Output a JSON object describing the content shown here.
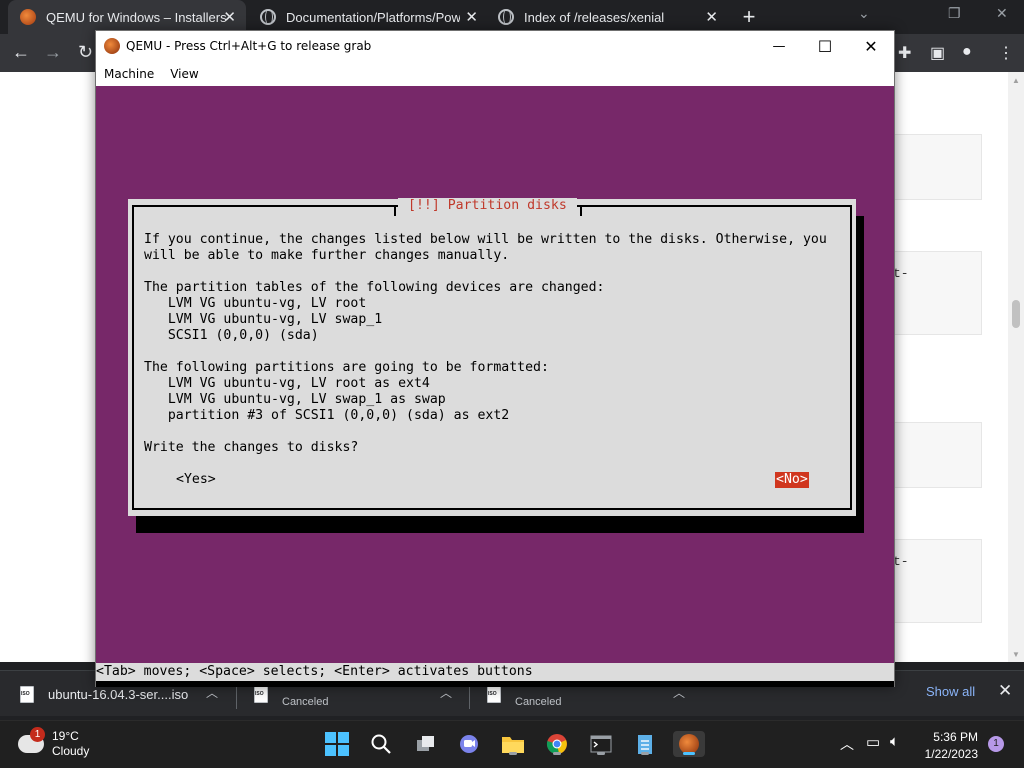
{
  "browser": {
    "tabs": [
      {
        "title": "QEMU for Windows – Installers (",
        "close": "✕"
      },
      {
        "title": "Documentation/Platforms/Power",
        "close": "✕"
      },
      {
        "title": "Index of /releases/xenial",
        "close": "✕"
      }
    ],
    "new_tab": "+",
    "page_fragments": [
      "t-",
      "t-"
    ]
  },
  "qemu": {
    "title": "QEMU - Press Ctrl+Alt+G to release grab",
    "menu": [
      "Machine",
      "View"
    ],
    "minimize": "—",
    "maximize": "☐",
    "close": "✕"
  },
  "dialog": {
    "title": "[!!] Partition disks",
    "lines": [
      "If you continue, the changes listed below will be written to the disks. Otherwise, you",
      "will be able to make further changes manually.",
      "",
      "The partition tables of the following devices are changed:",
      "   LVM VG ubuntu-vg, LV root",
      "   LVM VG ubuntu-vg, LV swap_1",
      "   SCSI1 (0,0,0) (sda)",
      "",
      "The following partitions are going to be formatted:",
      "   LVM VG ubuntu-vg, LV root as ext4",
      "   LVM VG ubuntu-vg, LV swap_1 as swap",
      "   partition #3 of SCSI1 (0,0,0) (sda) as ext2",
      "",
      "Write the changes to disks?"
    ],
    "yes_label": "<Yes>",
    "no_label": "<No>"
  },
  "status_line": "<Tab> moves; <Space> selects; <Enter> activates buttons",
  "downloads": {
    "items": [
      {
        "name": "ubuntu-16.04.3-ser....iso",
        "status": ""
      },
      {
        "name": "",
        "status": "Canceled"
      },
      {
        "name": "",
        "status": "Canceled"
      }
    ],
    "show_all": "Show all",
    "close": "✕"
  },
  "taskbar": {
    "weather_temp": "19°C",
    "weather_desc": "Cloudy",
    "weather_badge": "1",
    "time": "5:36 PM",
    "date": "1/22/2023",
    "notification_count": "1"
  },
  "colors": {
    "console_bg": "#772869",
    "dialog_bg": "#dcdcdc",
    "dialog_title": "#c0392b",
    "selected_button": "#d0361e"
  }
}
